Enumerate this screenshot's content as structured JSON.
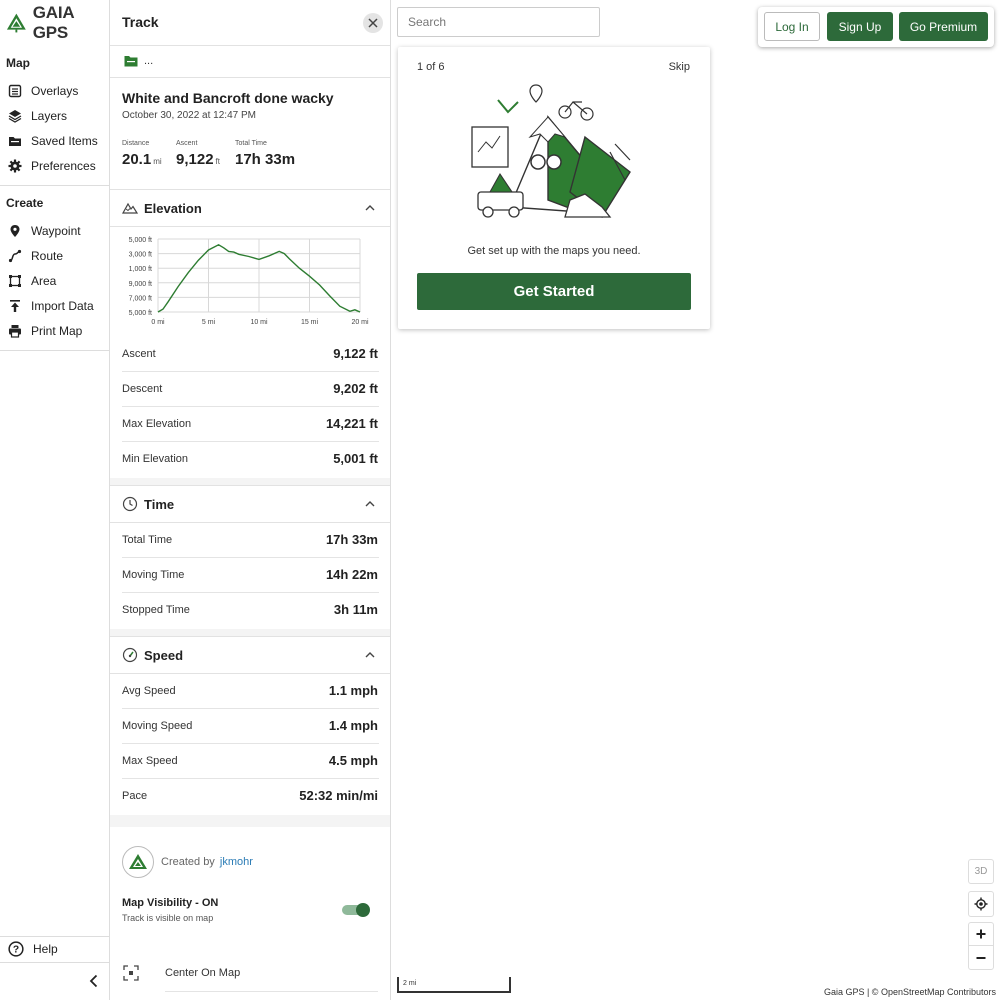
{
  "brand": {
    "name": "GAIA GPS",
    "color": "#2e7d32",
    "accent": "#2d6a3a"
  },
  "nav": {
    "map_section": "Map",
    "map_items": [
      {
        "label": "Overlays",
        "icon": "overlays-icon"
      },
      {
        "label": "Layers",
        "icon": "layers-icon"
      },
      {
        "label": "Saved Items",
        "icon": "folder-icon"
      },
      {
        "label": "Preferences",
        "icon": "gear-icon"
      }
    ],
    "create_section": "Create",
    "create_items": [
      {
        "label": "Waypoint",
        "icon": "pin-icon"
      },
      {
        "label": "Route",
        "icon": "route-icon"
      },
      {
        "label": "Area",
        "icon": "area-icon"
      },
      {
        "label": "Import Data",
        "icon": "upload-icon"
      },
      {
        "label": "Print Map",
        "icon": "print-icon"
      }
    ],
    "help": "Help",
    "collapse_icon": "chevron-left-icon"
  },
  "panel": {
    "title": "Track",
    "folder": "...",
    "track_name": "White and Bancroft done wacky",
    "date": "October 30, 2022 at 12:47 PM",
    "stats": {
      "distance_label": "Distance",
      "distance_value": "20.1",
      "distance_unit": "mi",
      "ascent_label": "Ascent",
      "ascent_value": "9,122",
      "ascent_unit": "ft",
      "time_label": "Total Time",
      "time_value": "17h 33m"
    },
    "elevation": {
      "title": "Elevation",
      "rows": [
        {
          "label": "Ascent",
          "value": "9,122 ft"
        },
        {
          "label": "Descent",
          "value": "9,202 ft"
        },
        {
          "label": "Max Elevation",
          "value": "14,221 ft"
        },
        {
          "label": "Min Elevation",
          "value": "5,001 ft"
        }
      ]
    },
    "time": {
      "title": "Time",
      "rows": [
        {
          "label": "Total Time",
          "value": "17h 33m"
        },
        {
          "label": "Moving Time",
          "value": "14h 22m"
        },
        {
          "label": "Stopped Time",
          "value": "3h 11m"
        }
      ]
    },
    "speed": {
      "title": "Speed",
      "rows": [
        {
          "label": "Avg Speed",
          "value": "1.1 mph"
        },
        {
          "label": "Moving Speed",
          "value": "1.4 mph"
        },
        {
          "label": "Max Speed",
          "value": "4.5 mph"
        },
        {
          "label": "Pace",
          "value": "52:32 min/mi"
        }
      ]
    },
    "created_by_label": "Created by",
    "created_by_user": "jkmohr",
    "visibility_title": "Map Visibility - ON",
    "visibility_sub": "Track is visible on map",
    "visibility_on": true,
    "center_on_map": "Center On Map"
  },
  "chart_data": {
    "type": "line",
    "ylabels": [
      "5,000 ft",
      "3,000 ft",
      "1,000 ft",
      "9,000 ft",
      "7,000 ft",
      "5,000 ft"
    ],
    "xlabels": [
      "0 mi",
      "5 mi",
      "10 mi",
      "15 mi",
      "20 mi"
    ],
    "xlim": [
      0,
      20
    ],
    "ylim": [
      5000,
      15000
    ],
    "x": [
      0,
      0.5,
      1,
      2,
      3,
      4,
      5,
      6,
      6.5,
      7,
      7.5,
      8,
      9,
      10,
      11,
      12,
      12.5,
      13,
      14,
      15,
      16,
      17,
      18,
      19,
      19.5,
      20
    ],
    "y": [
      5000,
      5400,
      6400,
      8500,
      10400,
      12100,
      13500,
      14200,
      13800,
      13300,
      13200,
      12900,
      12600,
      12200,
      12700,
      13300,
      13000,
      12300,
      11000,
      9900,
      8700,
      7200,
      5800,
      5100,
      5300,
      5000
    ],
    "line_color": "#2e7d32"
  },
  "map": {
    "search_placeholder": "Search",
    "login": "Log In",
    "signup": "Sign Up",
    "premium": "Go Premium",
    "onboard": {
      "step": "1 of 6",
      "skip": "Skip",
      "text": "Get set up with the maps you need.",
      "cta": "Get Started"
    },
    "btn_3d": "3D",
    "scale": "2 mi",
    "attribution": "Gaia GPS | © OpenStreetMap Contributors"
  }
}
